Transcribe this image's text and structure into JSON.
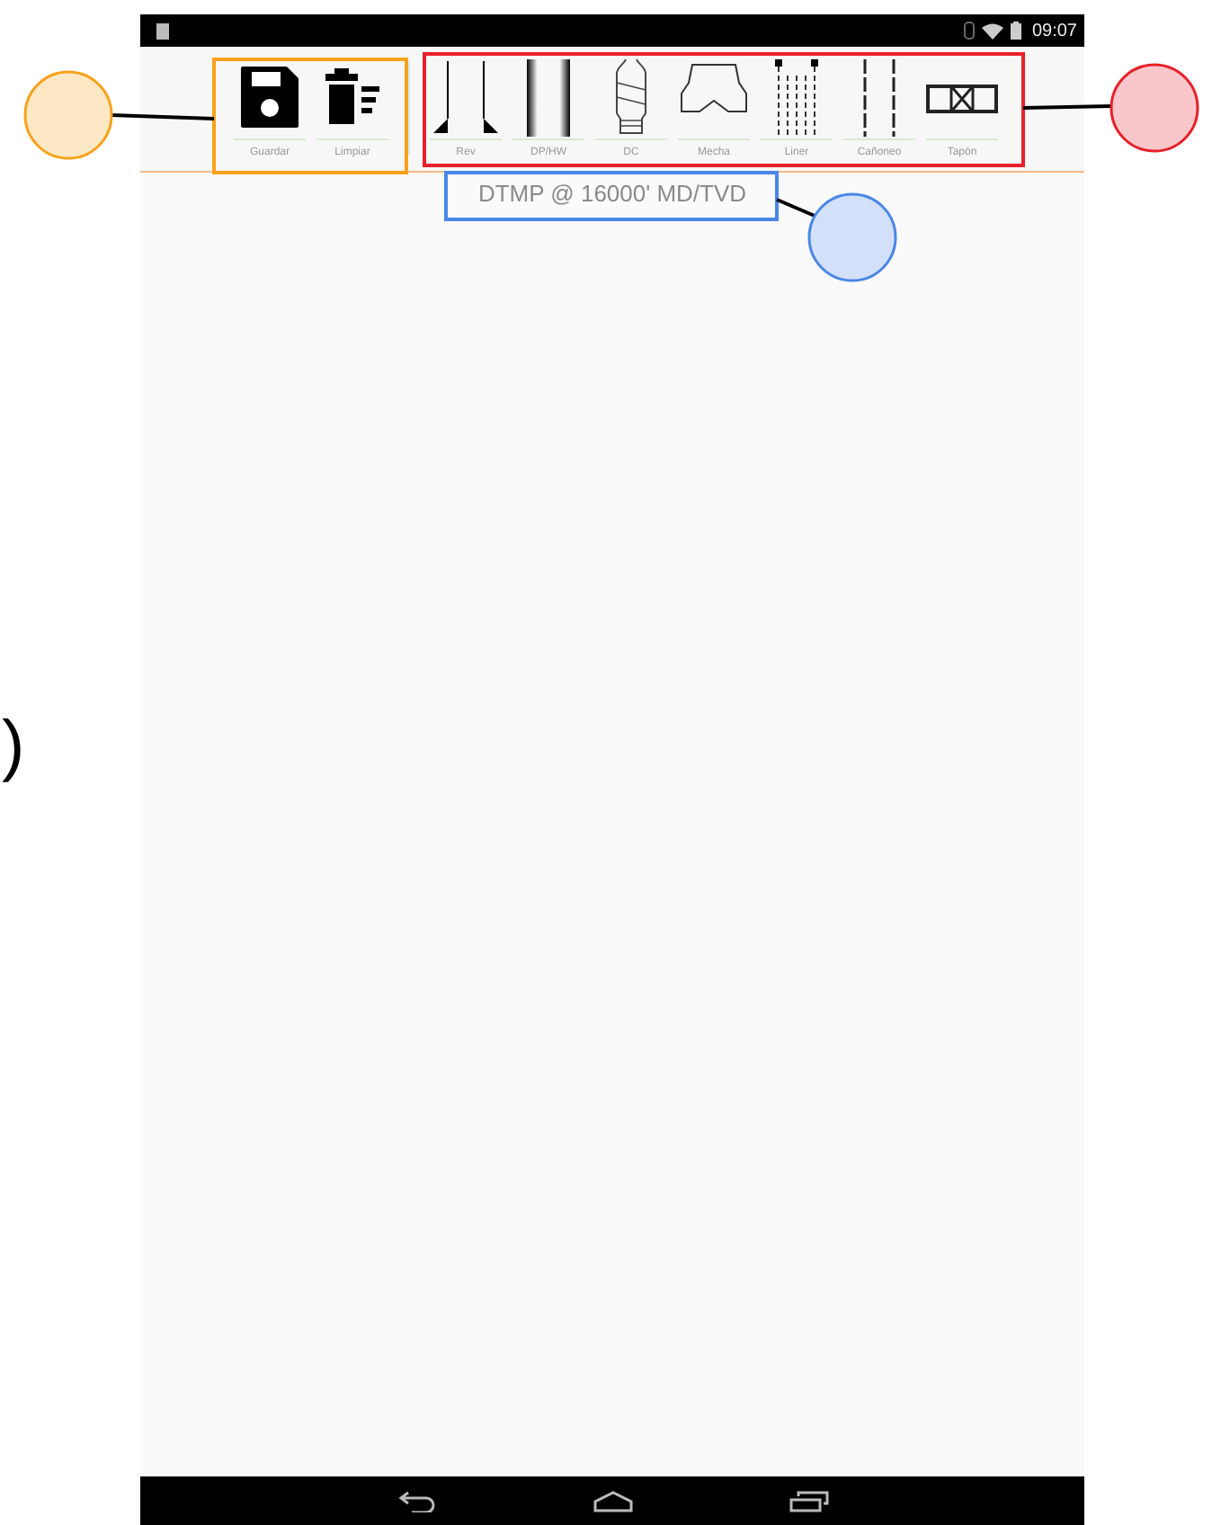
{
  "status_bar": {
    "time": "09:07"
  },
  "toolbar": {
    "file_items": [
      {
        "label": "Guardar",
        "kind": "save"
      },
      {
        "label": "Limpiar",
        "kind": "clear"
      }
    ],
    "tool_items": [
      {
        "label": "Rev",
        "kind": "rev"
      },
      {
        "label": "DP/HW",
        "kind": "pipe"
      },
      {
        "label": "DC",
        "kind": "collar"
      },
      {
        "label": "Mecha",
        "kind": "bit"
      },
      {
        "label": "Liner",
        "kind": "liner"
      },
      {
        "label": "Cañoneo",
        "kind": "perforation"
      },
      {
        "label": "Tapón",
        "kind": "plug"
      }
    ]
  },
  "canvas": {
    "depth_label": "DTMP @ 16000' MD/TVD"
  },
  "annotations": [
    {
      "color": "#f7a21b"
    },
    {
      "color": "#e8202a"
    },
    {
      "color": "#4a86e8"
    }
  ],
  "edge_text": ")"
}
